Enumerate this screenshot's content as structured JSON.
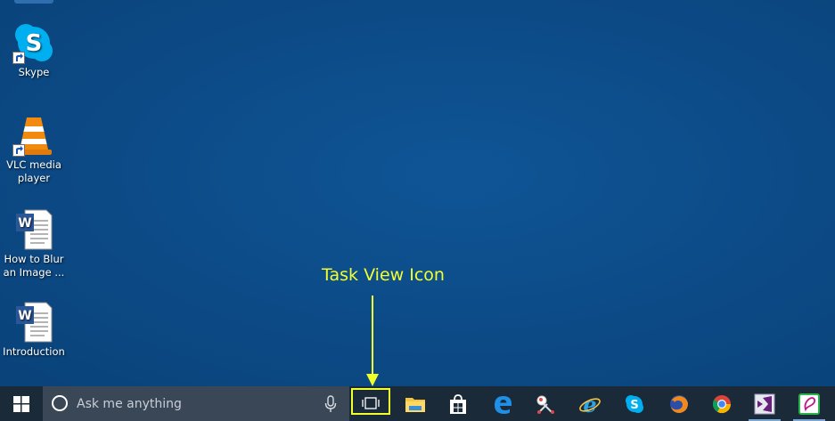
{
  "desktop": {
    "icons": [
      {
        "label": "Skype",
        "icon": "skype-icon"
      },
      {
        "label": "VLC media player",
        "icon": "vlc-cone-icon"
      },
      {
        "label": "How to Blur an Image ...",
        "icon": "word-document-icon"
      },
      {
        "label": "Introduction",
        "icon": "word-document-icon"
      }
    ]
  },
  "annotation": {
    "label": "Task View Icon",
    "color": "#f2ff2e"
  },
  "taskbar": {
    "search_placeholder": "Ask me anything",
    "background": "#1b2a38",
    "search_background": "#3a4757",
    "apps": [
      {
        "name": "file-explorer",
        "icon": "folder-icon"
      },
      {
        "name": "store",
        "icon": "store-bag-icon"
      },
      {
        "name": "edge",
        "icon": "edge-icon"
      },
      {
        "name": "snipping-tool",
        "icon": "scissors-icon"
      },
      {
        "name": "internet-explorer",
        "icon": "ie-icon"
      },
      {
        "name": "skype",
        "icon": "skype-icon"
      },
      {
        "name": "firefox",
        "icon": "firefox-icon"
      },
      {
        "name": "chrome",
        "icon": "chrome-icon"
      },
      {
        "name": "visual-studio",
        "icon": "visual-studio-icon"
      },
      {
        "name": "sketch-app",
        "icon": "green-sketch-icon"
      }
    ]
  }
}
